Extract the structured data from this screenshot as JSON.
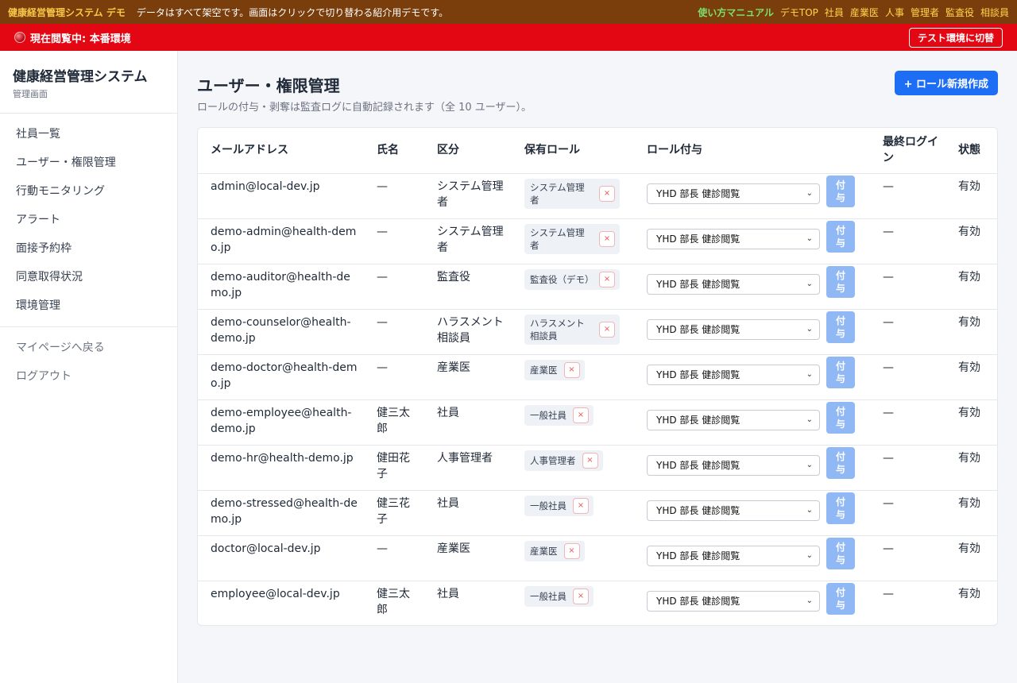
{
  "demo_bar": {
    "brand": "健康経営管理システム デモ",
    "note": "データはすべて架空です。画面はクリックで切り替わる紹介用デモです。",
    "links": [
      "使い方マニュアル",
      "デモTOP",
      "社員",
      "産業医",
      "人事",
      "管理者",
      "監査役",
      "相談員"
    ]
  },
  "env_bar": {
    "label": "現在閲覧中: 本番環境",
    "switch_label": "テスト環境に切替"
  },
  "sidebar": {
    "title": "健康経営管理システム",
    "subtitle": "管理画面",
    "items": [
      "社員一覧",
      "ユーザー・権限管理",
      "行動モニタリング",
      "アラート",
      "面接予約枠",
      "同意取得状況",
      "環境管理"
    ],
    "footer_items": [
      "マイページへ戻る",
      "ログアウト"
    ]
  },
  "main": {
    "title": "ユーザー・権限管理",
    "description": "ロールの付与・剥奪は監査ログに自動記録されます（全 10 ユーザー）。",
    "new_role_button": "+ ロール新規作成"
  },
  "table": {
    "headers": {
      "email": "メールアドレス",
      "name": "氏名",
      "kubun": "区分",
      "roles": "保有ロール",
      "grant": "ロール付与",
      "last_login": "最終ログイン",
      "state": "状態"
    },
    "select_value": "YHD 部長 健診閲覧",
    "grant_button": "付与",
    "chip_remove": "×",
    "rows": [
      {
        "email": "admin@local-dev.jp",
        "name": "—",
        "kubun": "システム管理者",
        "role": "システム管理者",
        "last_login": "—",
        "state": "有効"
      },
      {
        "email": "demo-admin@health-demo.jp",
        "name": "—",
        "kubun": "システム管理者",
        "role": "システム管理者",
        "last_login": "—",
        "state": "有効"
      },
      {
        "email": "demo-auditor@health-demo.jp",
        "name": "—",
        "kubun": "監査役",
        "role": "監査役（デモ）",
        "last_login": "—",
        "state": "有効"
      },
      {
        "email": "demo-counselor@health-demo.jp",
        "name": "—",
        "kubun": "ハラスメント相談員",
        "role": "ハラスメント相談員",
        "last_login": "—",
        "state": "有効"
      },
      {
        "email": "demo-doctor@health-demo.jp",
        "name": "—",
        "kubun": "産業医",
        "role": "産業医",
        "last_login": "—",
        "state": "有効"
      },
      {
        "email": "demo-employee@health-demo.jp",
        "name": "健三太郎",
        "kubun": "社員",
        "role": "一般社員",
        "last_login": "—",
        "state": "有効"
      },
      {
        "email": "demo-hr@health-demo.jp",
        "name": "健田花子",
        "kubun": "人事管理者",
        "role": "人事管理者",
        "last_login": "—",
        "state": "有効"
      },
      {
        "email": "demo-stressed@health-demo.jp",
        "name": "健三花子",
        "kubun": "社員",
        "role": "一般社員",
        "last_login": "—",
        "state": "有効"
      },
      {
        "email": "doctor@local-dev.jp",
        "name": "—",
        "kubun": "産業医",
        "role": "産業医",
        "last_login": "—",
        "state": "有効"
      },
      {
        "email": "employee@local-dev.jp",
        "name": "健三太郎",
        "kubun": "社員",
        "role": "一般社員",
        "last_login": "—",
        "state": "有効"
      }
    ]
  },
  "colors": {
    "demo_bar_bg": "#7a3d0c",
    "env_bar_bg": "#e30613",
    "primary": "#1d6ef5",
    "grant_button": "#90b8f5"
  }
}
